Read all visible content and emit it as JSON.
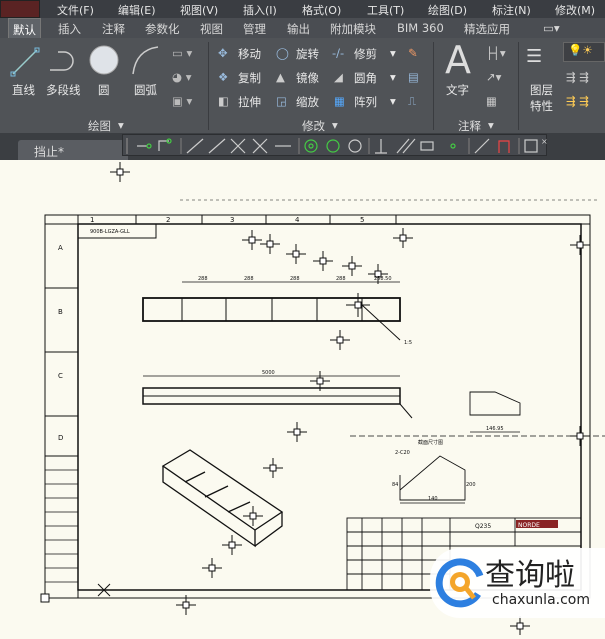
{
  "menubar": {
    "items": [
      "文件(F)",
      "编辑(E)",
      "视图(V)",
      "插入(I)",
      "格式(O)",
      "工具(T)",
      "绘图(D)",
      "标注(N)",
      "修改(M)"
    ]
  },
  "ribbon_tabs": [
    "默认",
    "插入",
    "注释",
    "参数化",
    "视图",
    "管理",
    "输出",
    "附加模块",
    "BIM 360",
    "精选应用"
  ],
  "draw_panel": {
    "line": "直线",
    "polyline": "多段线",
    "circle": "圆",
    "arc": "圆弧",
    "label": "绘图"
  },
  "modify_panel": {
    "move": "移动",
    "rotate": "旋转",
    "trim": "修剪",
    "copy": "复制",
    "mirror": "镜像",
    "fillet": "圆角",
    "stretch": "拉伸",
    "scale": "缩放",
    "array": "阵列",
    "label": "修改"
  },
  "annotation_panel": {
    "text": "文字",
    "label": "注释"
  },
  "layers_panel": {
    "layer_props_1": "图层",
    "layer_props_2": "特性"
  },
  "document_tab": "挡止*",
  "drawing": {
    "zones": [
      "A",
      "B",
      "C",
      "D"
    ],
    "columns": [
      "1",
      "2",
      "3",
      "4",
      "5"
    ],
    "drawing_no": "900B-LGZA-GLL",
    "dims_top": [
      "288",
      "288",
      "288",
      "288",
      "258.50"
    ],
    "dim_length": "5000",
    "scale_note": "1:5",
    "section_label": "截面尺寸图",
    "chamfer": "2-C20",
    "dim_140": "140",
    "dim_84": "84",
    "dim_200": "200",
    "material": "Q235",
    "company": "NORDE",
    "dim_14695": "146.95"
  },
  "watermark": {
    "title": "查询啦",
    "url": "chaxunla.com"
  },
  "colors": {
    "menubar": "#3a3d42",
    "ribbon": "#505357",
    "canvas": "#fbfaf0",
    "watermark_blue": "#2d7fe0",
    "watermark_orange": "#f4a52a"
  }
}
